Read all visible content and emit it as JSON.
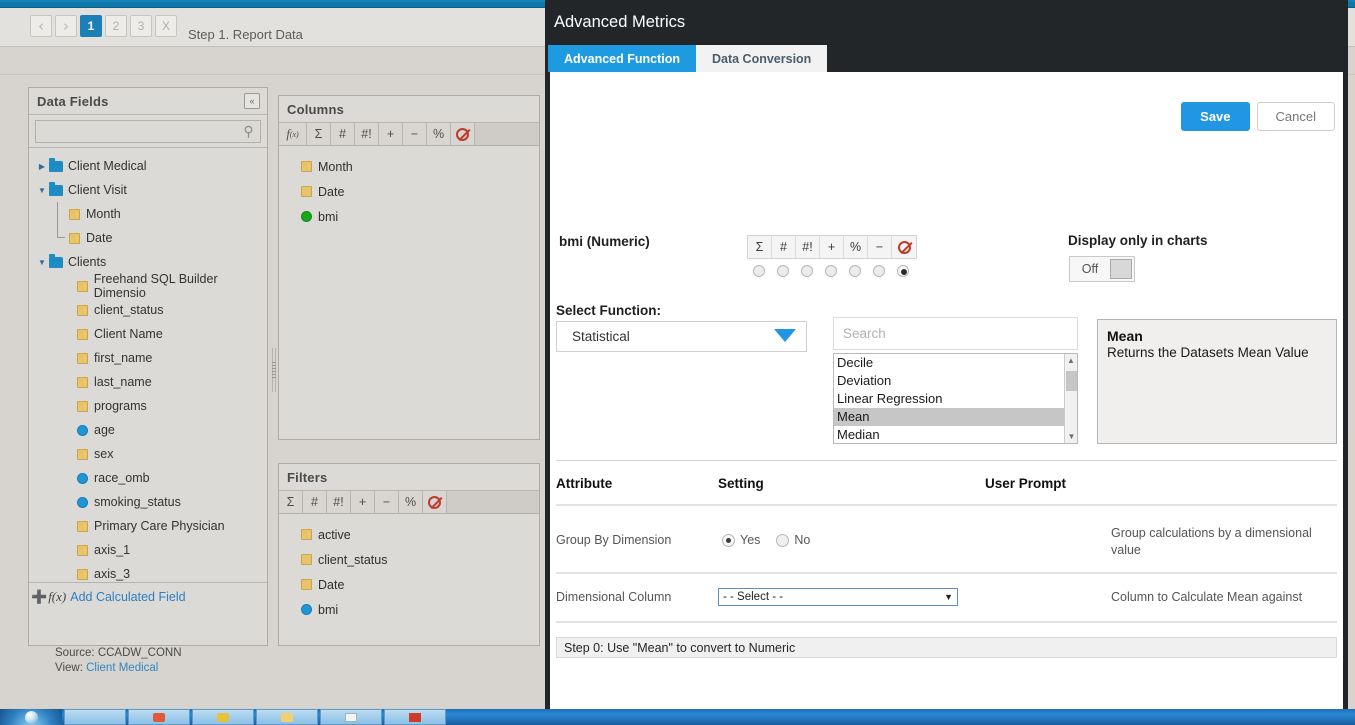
{
  "wizard": {
    "pager": {
      "prev": "‹",
      "next": "›",
      "pages": [
        "1",
        "2",
        "3"
      ],
      "close": "X",
      "active_page": "1"
    },
    "step_label": "Step 1. Report Data"
  },
  "data_fields": {
    "title": "Data Fields",
    "collapse_icon": "«",
    "search_value": "",
    "search_icon": "search-icon",
    "tree": [
      {
        "label": "Client Medical",
        "icon": "folder-blue",
        "twisty": "▶",
        "level": 0
      },
      {
        "label": "Client Visit",
        "icon": "folder-blue",
        "twisty": "▼",
        "level": 0
      },
      {
        "label": "Month",
        "icon": "folder-gold",
        "twisty": "",
        "level": 1
      },
      {
        "label": "Date",
        "icon": "folder-gold",
        "twisty": "",
        "level": 1
      },
      {
        "label": "Clients",
        "icon": "folder-blue",
        "twisty": "▼",
        "level": 0
      },
      {
        "label": "Freehand SQL Builder Dimensio",
        "icon": "folder-gold",
        "twisty": "",
        "level": 2
      },
      {
        "label": "client_status",
        "icon": "folder-gold",
        "twisty": "",
        "level": 2
      },
      {
        "label": "Client Name",
        "icon": "folder-gold",
        "twisty": "",
        "level": 2
      },
      {
        "label": "first_name",
        "icon": "folder-gold",
        "twisty": "",
        "level": 2
      },
      {
        "label": "last_name",
        "icon": "folder-gold",
        "twisty": "",
        "level": 2
      },
      {
        "label": "programs",
        "icon": "folder-gold",
        "twisty": "",
        "level": 2
      },
      {
        "label": "age",
        "icon": "dot-blue",
        "twisty": "",
        "level": 2
      },
      {
        "label": "sex",
        "icon": "folder-gold",
        "twisty": "",
        "level": 2
      },
      {
        "label": "race_omb",
        "icon": "dot-blue",
        "twisty": "",
        "level": 2
      },
      {
        "label": "smoking_status",
        "icon": "dot-blue",
        "twisty": "",
        "level": 2
      },
      {
        "label": "Primary Care Physician",
        "icon": "folder-gold",
        "twisty": "",
        "level": 2
      },
      {
        "label": "axis_1",
        "icon": "folder-gold",
        "twisty": "",
        "level": 2
      },
      {
        "label": "axis_3",
        "icon": "folder-gold",
        "twisty": "",
        "level": 2
      }
    ],
    "add_calculated_field": "Add Calculated Field",
    "source_line": "Source: CCADW_CONN",
    "view_prefix": "View:",
    "view_value": "Client Medical"
  },
  "columns_panel": {
    "title": "Columns",
    "toolbar": [
      "f(x)",
      "Σ",
      "#",
      "#!",
      "+",
      "−",
      "%",
      "no-entry"
    ],
    "items": [
      {
        "label": "Month",
        "icon": "folder-gold"
      },
      {
        "label": "Date",
        "icon": "folder-gold"
      },
      {
        "label": "bmi",
        "icon": "dot-green"
      }
    ]
  },
  "filters_panel": {
    "title": "Filters",
    "toolbar": [
      "Σ",
      "#",
      "#!",
      "+",
      "−",
      "%",
      "no-entry"
    ],
    "items": [
      {
        "label": "active",
        "icon": "folder-gold"
      },
      {
        "label": "client_status",
        "icon": "folder-gold"
      },
      {
        "label": "Date",
        "icon": "folder-gold"
      },
      {
        "label": "bmi",
        "icon": "dot-blue"
      }
    ]
  },
  "dialog": {
    "title": "Advanced Metrics",
    "tabs": [
      {
        "label": "Advanced Function",
        "active": true
      },
      {
        "label": "Data Conversion",
        "active": false
      }
    ],
    "save_label": "Save",
    "cancel_label": "Cancel",
    "metric_label": "bmi (Numeric)",
    "metric_toolbar": [
      "Σ",
      "#",
      "#!",
      "+",
      "%",
      "−",
      "no-entry"
    ],
    "metric_selected_index": 6,
    "display_only_label": "Display only in charts",
    "display_only_state": "Off",
    "select_function_label": "Select Function:",
    "function_category": "Statistical",
    "search_placeholder": "Search",
    "search_value": "",
    "function_list": [
      "Decile",
      "Deviation",
      "Linear Regression",
      "Mean",
      "Median"
    ],
    "function_selected": "Mean",
    "description_title": "Mean",
    "description_body": "Returns the Datasets Mean Value",
    "table_headers": {
      "attribute": "Attribute",
      "setting": "Setting",
      "user_prompt": "User Prompt"
    },
    "rows": [
      {
        "attribute": "Group By Dimension",
        "setting_type": "radio",
        "options": [
          {
            "label": "Yes",
            "selected": true
          },
          {
            "label": "No",
            "selected": false
          }
        ],
        "description": "Group calculations by a dimensional value"
      },
      {
        "attribute": "Dimensional Column",
        "setting_type": "select",
        "value": "- - Select - -",
        "description": "Column to Calculate Mean against"
      }
    ],
    "step_note": "Step 0: Use \"Mean\" to convert to Numeric"
  },
  "colors": {
    "accent_blue": "#2196e3",
    "title_bar": "#232629",
    "tab_active": "#1e9ae0",
    "top_bar": "#1681b5"
  }
}
